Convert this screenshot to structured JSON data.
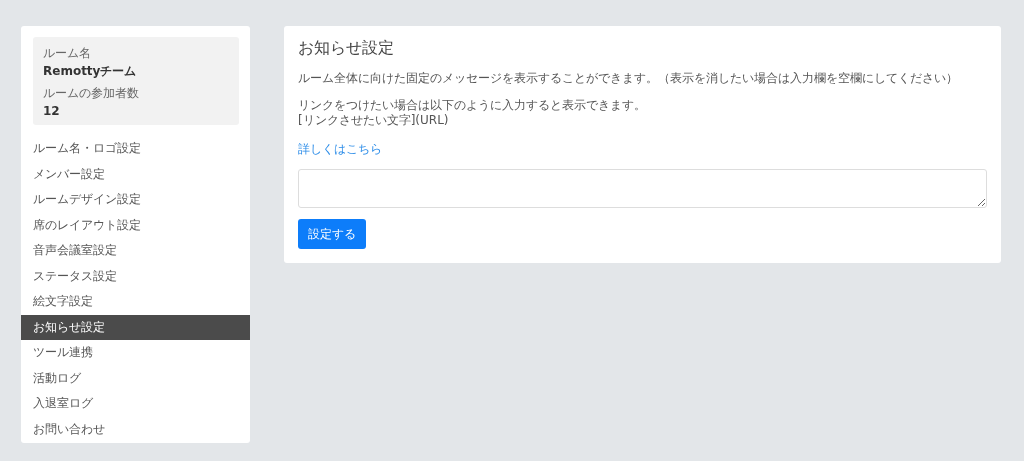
{
  "room_info": {
    "name_label": "ルーム名",
    "name": "Remottyチーム",
    "count_label": "ルームの参加者数",
    "count": "12"
  },
  "sidebar": {
    "items": [
      {
        "label": "ルーム名・ロゴ設定",
        "selected": false
      },
      {
        "label": "メンバー設定",
        "selected": false
      },
      {
        "label": "ルームデザイン設定",
        "selected": false
      },
      {
        "label": "席のレイアウト設定",
        "selected": false
      },
      {
        "label": "音声会議室設定",
        "selected": false
      },
      {
        "label": "ステータス設定",
        "selected": false
      },
      {
        "label": "絵文字設定",
        "selected": false
      },
      {
        "label": "お知らせ設定",
        "selected": true
      },
      {
        "label": "ツール連携",
        "selected": false
      },
      {
        "label": "活動ログ",
        "selected": false
      },
      {
        "label": "入退室ログ",
        "selected": false
      },
      {
        "label": "お問い合わせ",
        "selected": false
      }
    ]
  },
  "main": {
    "title": "お知らせ設定",
    "description": "ルーム全体に向けた固定のメッセージを表示することができます。（表示を消したい場合は入力欄を空欄にしてください）",
    "link_help_lines": [
      "リンクをつけたい場合は以下のように入力すると表示できます。",
      "[リンクさせたい文字](URL)"
    ],
    "details_link": "詳しくはこちら",
    "submit_button": "設定する"
  }
}
